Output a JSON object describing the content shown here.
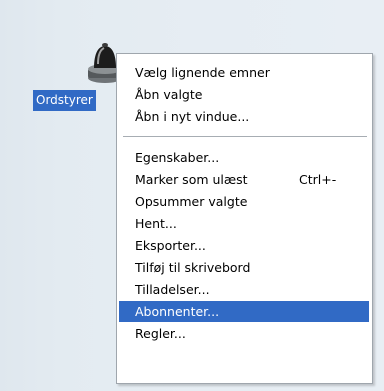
{
  "desktop": {
    "icon": "bell-icon",
    "icon_label": "Ordstyrer"
  },
  "context_menu": {
    "group1": [
      {
        "label": "Vælg lignende emner"
      },
      {
        "label": "Åbn valgte"
      },
      {
        "label": "Åbn i nyt vindue..."
      }
    ],
    "group2": [
      {
        "label": "Egenskaber..."
      },
      {
        "label": "Marker som ulæst",
        "shortcut": "Ctrl+-"
      },
      {
        "label": "Opsummer valgte"
      },
      {
        "label": "Hent..."
      },
      {
        "label": "Eksporter..."
      },
      {
        "label": "Tilføj til skrivebord"
      },
      {
        "label": "Tilladelser..."
      },
      {
        "label": "Abonnenter...",
        "selected": true
      },
      {
        "label": "Regler..."
      }
    ]
  },
  "colors": {
    "selection": "#316ac5",
    "selection_text": "#ffffff",
    "menu_bg": "#ffffff",
    "desktop_bg": "#e6edf3"
  }
}
